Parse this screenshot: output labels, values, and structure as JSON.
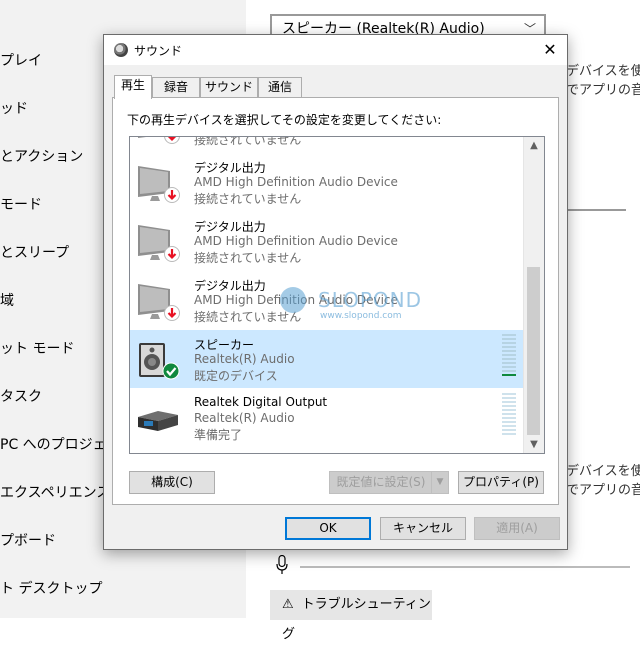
{
  "settings": {
    "left_items": [
      "プレイ",
      "ッド",
      "とアクション",
      "モード",
      "とスリープ",
      "域",
      "ット モード",
      "タスク",
      "PC へのプロジェクシ",
      "エクスペリエンス",
      "プボード",
      "ト デスクトップ"
    ],
    "output_device_select": "スピーカー (Realtek(R) Audio)",
    "side_text_top": [
      "デバイスを使用",
      "でアプリの音量"
    ],
    "side_text_bottom": [
      "デバイスを使用",
      "でアプリの音量"
    ],
    "troubleshoot_label": "トラブルシューティング"
  },
  "dialog": {
    "title": "サウンド",
    "close_glyph": "✕",
    "tabs": [
      "再生",
      "録音",
      "サウンド",
      "通信"
    ],
    "active_tab": "再生",
    "instruction": "下の再生デバイスを選択してその設定を変更してください:",
    "devices": [
      {
        "name": "",
        "description": "",
        "status": "接続されていません",
        "kind": "monitor-disconnected"
      },
      {
        "name": "デジタル出力",
        "description": "AMD High Definition Audio Device",
        "status": "接続されていません",
        "kind": "monitor-disconnected"
      },
      {
        "name": "デジタル出力",
        "description": "AMD High Definition Audio Device",
        "status": "接続されていません",
        "kind": "monitor-disconnected"
      },
      {
        "name": "デジタル出力",
        "description": "AMD High Definition Audio Device",
        "status": "接続されていません",
        "kind": "monitor-disconnected"
      },
      {
        "name": "スピーカー",
        "description": "Realtek(R) Audio",
        "status": "既定のデバイス",
        "kind": "speaker-default",
        "selected": true
      },
      {
        "name": "Realtek Digital Output",
        "description": "Realtek(R) Audio",
        "status": "準備完了",
        "kind": "digital-output"
      }
    ],
    "watermark": {
      "text": "SLOPOND",
      "sub": "www.slopond.com"
    },
    "buttons": {
      "configure": "構成(C)",
      "set_default": "既定値に設定(S)",
      "properties": "プロパティ(P)",
      "ok": "OK",
      "cancel": "キャンセル",
      "apply": "適用(A)"
    },
    "colors": {
      "selection": "#cce8ff",
      "accent": "#0078d7",
      "disconnected_badge": "#e81123",
      "default_badge": "#10893e"
    }
  }
}
